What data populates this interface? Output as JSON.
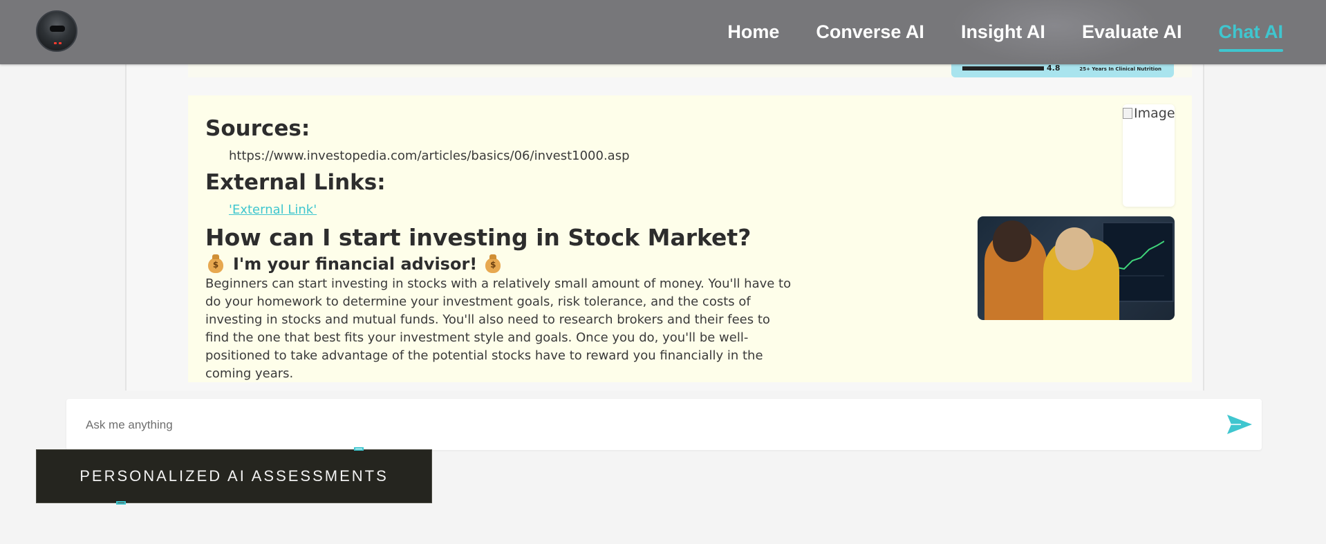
{
  "navbar": {
    "links": [
      {
        "label": "Home"
      },
      {
        "label": "Converse AI"
      },
      {
        "label": "Insight AI"
      },
      {
        "label": "Evaluate AI"
      },
      {
        "label": "Chat AI",
        "active": true
      }
    ]
  },
  "previous_card": {
    "rating": "4.8",
    "years_badge": "25+ Years In Clinical Nutrition"
  },
  "answer": {
    "sources_heading": "Sources:",
    "source_url": "https://www.investopedia.com/articles/basics/06/invest1000.asp",
    "external_links_heading": "External Links:",
    "external_link_label": "'External Link'",
    "question": "How can I start investing in Stock Market?",
    "advisor_text": "I'm your financial advisor!",
    "advisor_icon": "money-bag-icon",
    "body": "Beginners can start investing in stocks with a relatively small amount of money. You'll have to do your homework to determine your investment goals, risk tolerance, and the costs of investing in stocks and mutual funds. You'll also need to research brokers and their fees to find the one that best fits your investment style and goals. Once you do, you'll be well-positioned to take advantage of the potential stocks have to reward you financially in the coming years.",
    "broken_image_alt": "Image"
  },
  "chat_input": {
    "placeholder": "Ask me anything",
    "send_icon": "send-icon"
  },
  "overlay": {
    "label": "PERSONALIZED AI ASSESSMENTS"
  },
  "colors": {
    "accent": "#3fc6cf",
    "navbar": "#77777a",
    "answer_bg": "#fefeea",
    "overlay_bg": "#25251f"
  }
}
